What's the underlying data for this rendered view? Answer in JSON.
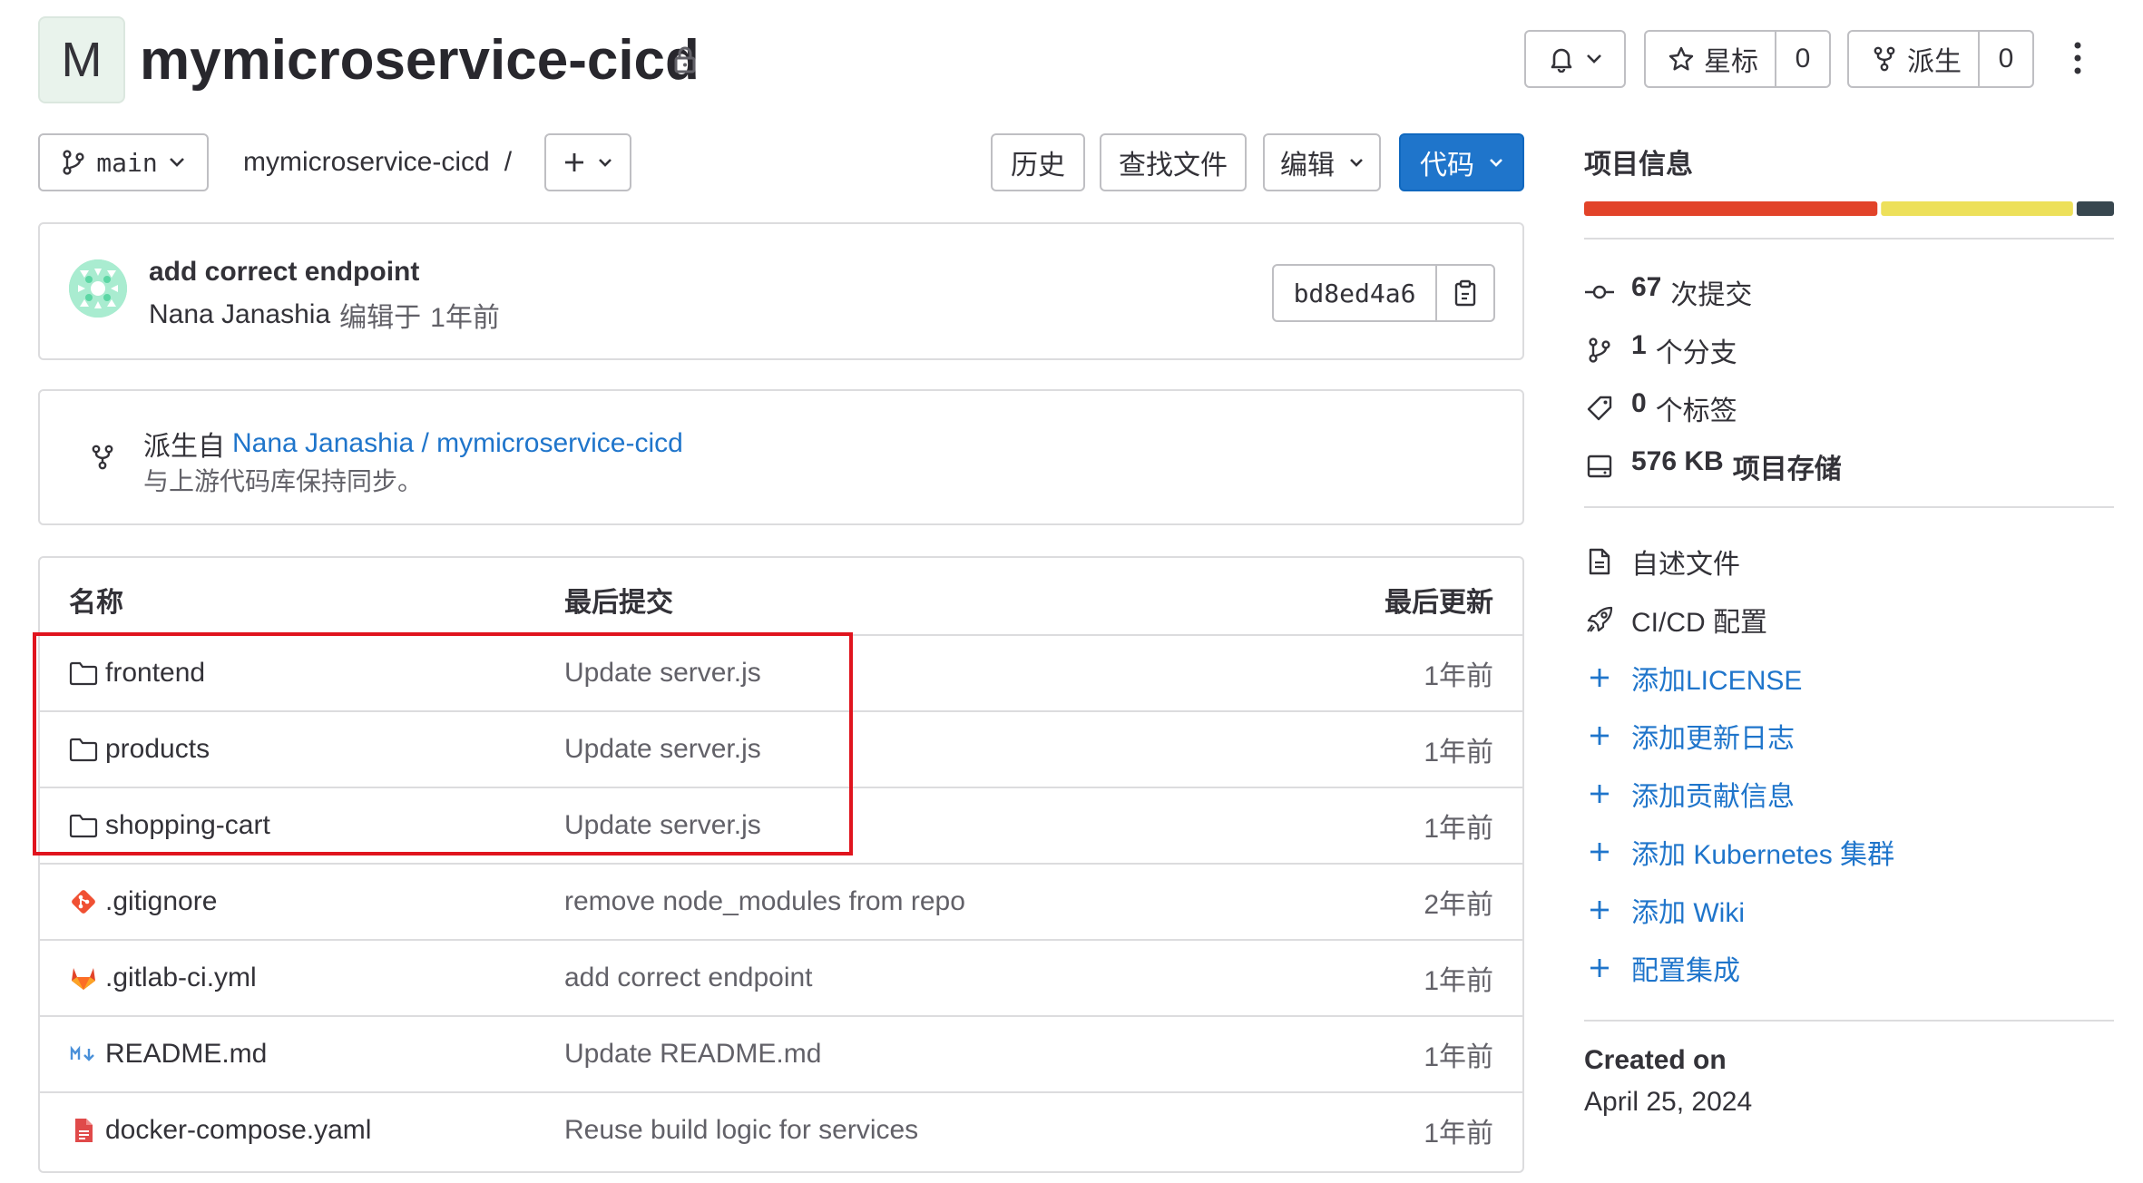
{
  "project": {
    "avatar_letter": "M",
    "name": "mymicroservice-cicd",
    "lock_icon": "lock-icon"
  },
  "header_actions": {
    "star_label": "星标",
    "star_count": "0",
    "fork_label": "派生",
    "fork_count": "0"
  },
  "toolbar": {
    "branch": "main",
    "path_root": "mymicroservice-cicd",
    "path_sep": "/",
    "history": "历史",
    "find_file": "查找文件",
    "edit": "编辑",
    "code": "代码"
  },
  "last_commit": {
    "message": "add correct endpoint",
    "author": "Nana Janashia",
    "action": "编辑于",
    "time": "1年前",
    "sha": "bd8ed4a6"
  },
  "fork_info": {
    "prefix": "派生自",
    "source": "Nana Janashia / mymicroservice-cicd",
    "status": "与上游代码库保持同步。"
  },
  "file_table": {
    "headers": {
      "name": "名称",
      "last_commit": "最后提交",
      "last_update": "最后更新"
    },
    "rows": [
      {
        "icon": "folder-icon",
        "name": "frontend",
        "commit": "Update server.js",
        "time": "1年前"
      },
      {
        "icon": "folder-icon",
        "name": "products",
        "commit": "Update server.js",
        "time": "1年前"
      },
      {
        "icon": "folder-icon",
        "name": "shopping-cart",
        "commit": "Update server.js",
        "time": "1年前"
      },
      {
        "icon": "git-icon",
        "name": ".gitignore",
        "commit": "remove node_modules from repo",
        "time": "2年前"
      },
      {
        "icon": "gitlab-icon",
        "name": ".gitlab-ci.yml",
        "commit": "add correct endpoint",
        "time": "1年前"
      },
      {
        "icon": "markdown-icon",
        "name": "README.md",
        "commit": "Update README.md",
        "time": "1年前"
      },
      {
        "icon": "yaml-file-icon",
        "name": "docker-compose.yaml",
        "commit": "Reuse build logic for services",
        "time": "1年前"
      }
    ]
  },
  "sidebar": {
    "title": "项目信息",
    "language_bar": [
      {
        "color": "#e24329",
        "fraction": 0.55
      },
      {
        "color": "#ede05a",
        "fraction": 0.36
      },
      {
        "color": "#38474f",
        "fraction": 0.07
      }
    ],
    "stats": [
      {
        "icon": "commit-icon",
        "count": "67",
        "label": "次提交"
      },
      {
        "icon": "branch-icon",
        "count": "1",
        "label": "个分支"
      },
      {
        "icon": "tag-icon",
        "count": "0",
        "label": "个标签"
      },
      {
        "icon": "storage-icon",
        "count": "576 KB",
        "label": "项目存储"
      }
    ],
    "files": [
      {
        "icon": "document-icon",
        "label": "自述文件"
      },
      {
        "icon": "rocket-icon",
        "label": "CI/CD 配置"
      }
    ],
    "add_links": [
      "添加LICENSE",
      "添加更新日志",
      "添加贡献信息",
      "添加 Kubernetes 集群",
      "添加 Wiki",
      "配置集成"
    ],
    "created_label": "Created on",
    "created_date": "April 25, 2024"
  },
  "highlight_color": "#e0141e"
}
